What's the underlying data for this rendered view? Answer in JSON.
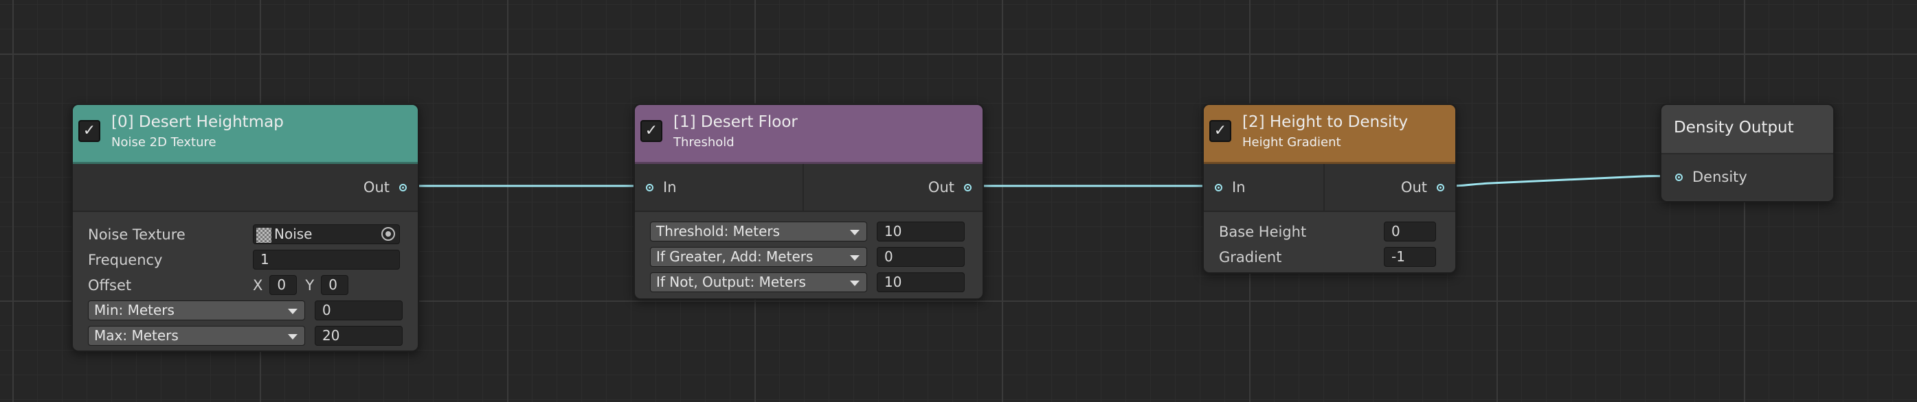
{
  "colors": {
    "background": "#262626",
    "node_body": "#383838",
    "edge": "#9fe5ef",
    "noise_header": "#4e9a8b",
    "threshold_header": "#7c5b82",
    "gradient_header": "#9a6a34",
    "output_header": "#424242"
  },
  "nodes": {
    "heightmap": {
      "title": "[0] Desert Heightmap",
      "subtitle": "Noise 2D Texture",
      "enabled": true,
      "out_label": "Out",
      "props": {
        "noise_texture_label": "Noise Texture",
        "noise_texture_value": "Noise",
        "frequency_label": "Frequency",
        "frequency_value": "1",
        "offset_label": "Offset",
        "offset_x_label": "X",
        "offset_x_value": "0",
        "offset_y_label": "Y",
        "offset_y_value": "0",
        "min_dropdown": "Min: Meters",
        "min_value": "0",
        "max_dropdown": "Max: Meters",
        "max_value": "20"
      }
    },
    "floor": {
      "title": "[1] Desert Floor",
      "subtitle": "Threshold",
      "enabled": true,
      "in_label": "In",
      "out_label": "Out",
      "props": {
        "threshold_dropdown": "Threshold: Meters",
        "threshold_value": "10",
        "greater_dropdown": "If Greater, Add: Meters",
        "greater_value": "0",
        "not_dropdown": "If Not, Output: Meters",
        "not_value": "10"
      }
    },
    "density": {
      "title": "[2] Height to Density",
      "subtitle": "Height Gradient",
      "enabled": true,
      "in_label": "In",
      "out_label": "Out",
      "props": {
        "base_height_label": "Base Height",
        "base_height_value": "0",
        "gradient_label": "Gradient",
        "gradient_value": "-1"
      }
    },
    "output": {
      "title": "Density Output",
      "in_label": "Density"
    }
  }
}
